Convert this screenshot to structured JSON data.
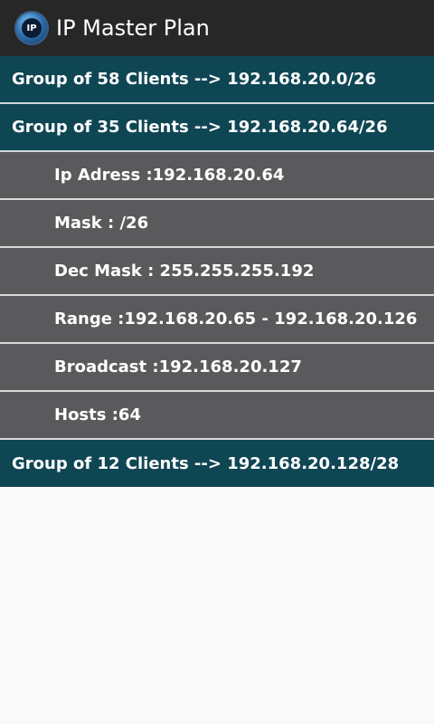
{
  "app": {
    "title": "IP Master Plan",
    "icon_text": "IP"
  },
  "groups": [
    {
      "label": "Group of 58 Clients --> 192.168.20.0/26"
    },
    {
      "label": "Group of 35 Clients --> 192.168.20.64/26",
      "details": [
        "Ip Adress :192.168.20.64",
        "Mask : /26",
        "Dec Mask : 255.255.255.192",
        "Range :192.168.20.65 - 192.168.20.126",
        "Broadcast :192.168.20.127",
        "Hosts :64"
      ]
    },
    {
      "label": "Group of 12 Clients --> 192.168.20.128/28"
    }
  ],
  "colors": {
    "action_bar": "#272727",
    "group_row": "#0f4654",
    "child_row": "#5a5a5c",
    "background": "#f9f9f9"
  }
}
